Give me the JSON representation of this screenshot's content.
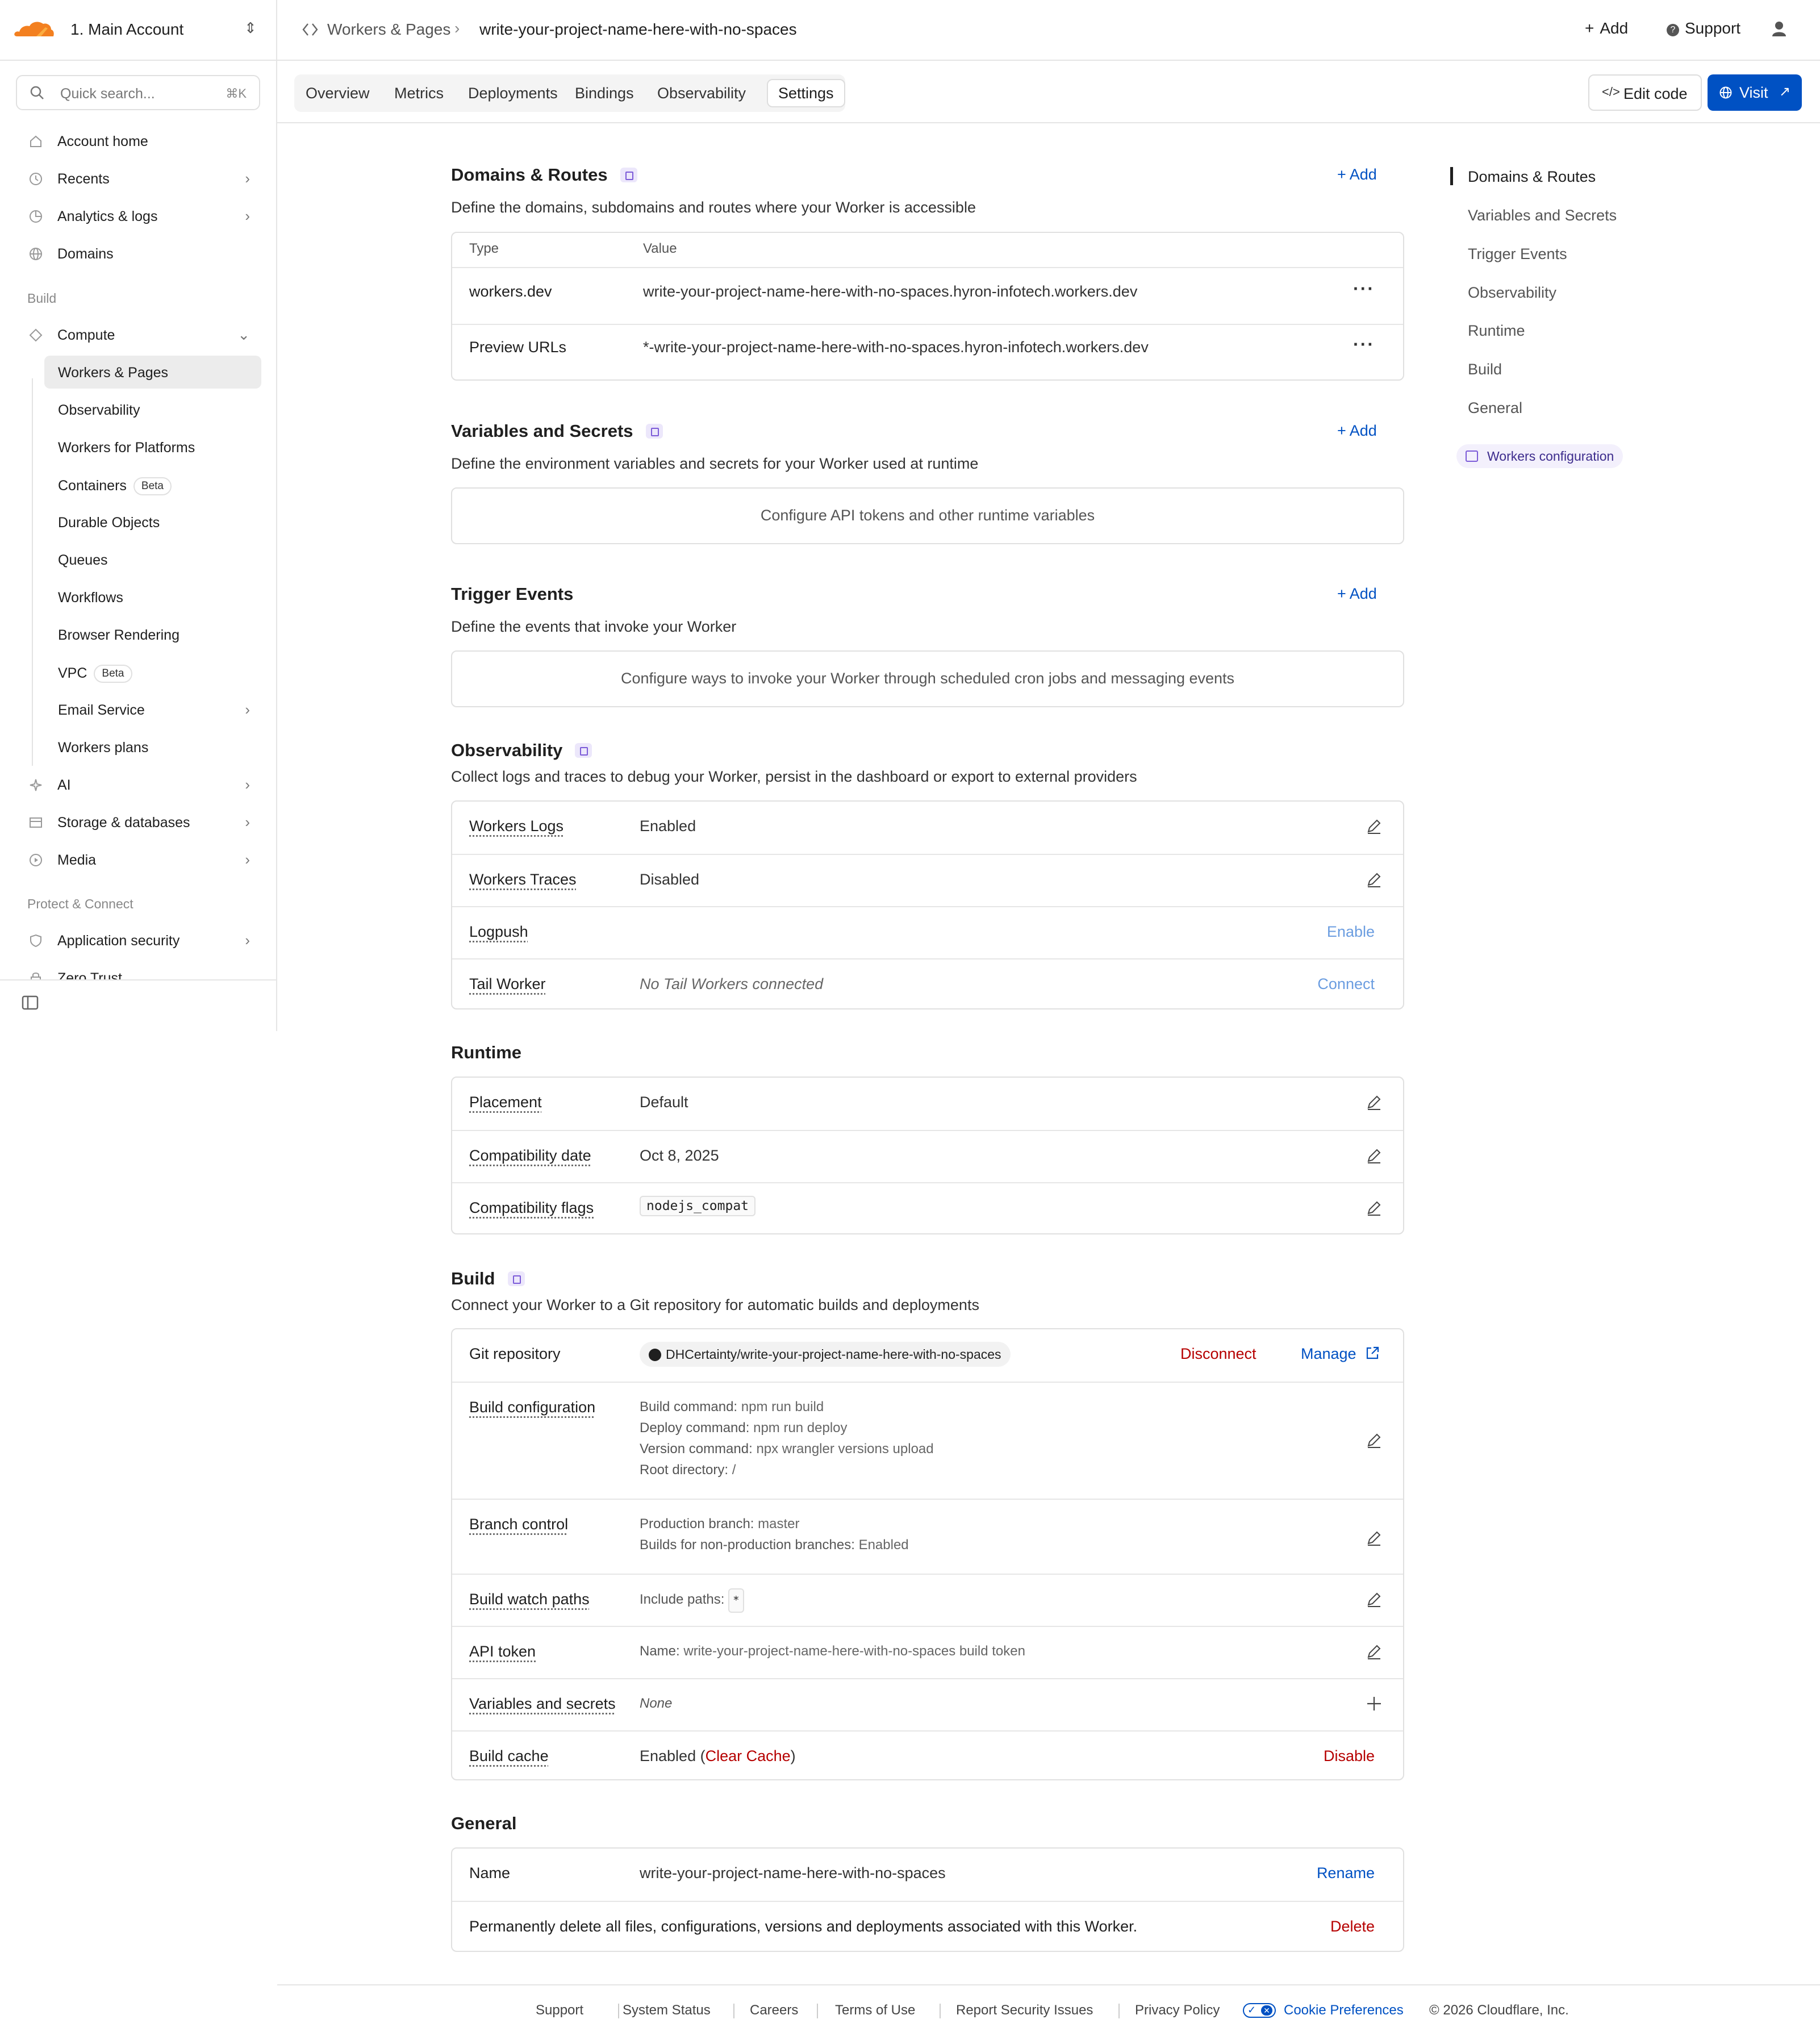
{
  "account": {
    "name": "1. Main Account"
  },
  "search": {
    "placeholder": "Quick search...",
    "shortcut": "⌘K"
  },
  "sidebar": {
    "top_items": [
      {
        "label": "Account home"
      },
      {
        "label": "Recents"
      },
      {
        "label": "Analytics & logs"
      },
      {
        "label": "Domains"
      }
    ],
    "build_heading": "Build",
    "compute": {
      "label": "Compute"
    },
    "compute_items": [
      {
        "label": "Workers & Pages"
      },
      {
        "label": "Observability"
      },
      {
        "label": "Workers for Platforms"
      },
      {
        "label": "Containers",
        "badge": "Beta"
      },
      {
        "label": "Durable Objects"
      },
      {
        "label": "Queues"
      },
      {
        "label": "Workflows"
      },
      {
        "label": "Browser Rendering"
      },
      {
        "label": "VPC",
        "badge": "Beta"
      },
      {
        "label": "Email Service"
      },
      {
        "label": "Workers plans"
      }
    ],
    "more_items": [
      {
        "label": "AI"
      },
      {
        "label": "Storage & databases"
      },
      {
        "label": "Media"
      }
    ],
    "protect_heading": "Protect & Connect",
    "protect_items": [
      {
        "label": "Application security"
      },
      {
        "label": "Zero Trust"
      }
    ]
  },
  "topbar": {
    "breadcrumb_parent": "Workers & Pages",
    "breadcrumb_current": "write-your-project-name-here-with-no-spaces",
    "add_label": "Add",
    "support_label": "Support"
  },
  "tabs": [
    "Overview",
    "Metrics",
    "Deployments",
    "Bindings",
    "Observability",
    "Settings"
  ],
  "actions": {
    "edit_code": "Edit code",
    "visit": "Visit"
  },
  "domains": {
    "title": "Domains & Routes",
    "add": "Add",
    "description": "Define the domains, subdomains and routes where your Worker is accessible",
    "col_type": "Type",
    "col_value": "Value",
    "rows": [
      {
        "type": "workers.dev",
        "value": "write-your-project-name-here-with-no-spaces.hyron-infotech.workers.dev"
      },
      {
        "type": "Preview URLs",
        "value": "*-write-your-project-name-here-with-no-spaces.hyron-infotech.workers.dev"
      }
    ]
  },
  "variables": {
    "title": "Variables and Secrets",
    "add": "Add",
    "description": "Define the environment variables and secrets for your Worker used at runtime",
    "empty": "Configure API tokens and other runtime variables"
  },
  "triggers": {
    "title": "Trigger Events",
    "add": "Add",
    "description": "Define the events that invoke your Worker",
    "empty": "Configure ways to invoke your Worker through scheduled cron jobs and messaging events"
  },
  "observability": {
    "title": "Observability",
    "description": "Collect logs and traces to debug your Worker, persist in the dashboard or export to external providers",
    "rows": [
      {
        "label": "Workers Logs",
        "value": "Enabled"
      },
      {
        "label": "Workers Traces",
        "value": "Disabled"
      },
      {
        "label": "Logpush",
        "value": "",
        "action": "Enable"
      },
      {
        "label": "Tail Worker",
        "value": "No Tail Workers connected",
        "action": "Connect"
      }
    ]
  },
  "runtime": {
    "title": "Runtime",
    "rows": [
      {
        "label": "Placement",
        "value": "Default"
      },
      {
        "label": "Compatibility date",
        "value": "Oct 8, 2025"
      },
      {
        "label": "Compatibility flags",
        "value": "nodejs_compat"
      }
    ]
  },
  "build": {
    "title": "Build",
    "description": "Connect your Worker to a Git repository for automatic builds and deployments",
    "git": {
      "label": "Git repository",
      "repo": "DHCertainty/write-your-project-name-here-with-no-spaces",
      "disconnect": "Disconnect",
      "manage": "Manage"
    },
    "config": {
      "label": "Build configuration",
      "lines": [
        {
          "k": "Build command:",
          "v": "npm run build"
        },
        {
          "k": "Deploy command:",
          "v": "npm run deploy"
        },
        {
          "k": "Version command:",
          "v": "npx wrangler versions upload"
        },
        {
          "k": "Root directory:",
          "v": "/"
        }
      ]
    },
    "branch": {
      "label": "Branch control",
      "lines": [
        {
          "k": "Production branch:",
          "v": "master"
        },
        {
          "k": "Builds for non-production branches:",
          "v": "Enabled"
        }
      ]
    },
    "watch": {
      "label": "Build watch paths",
      "k": "Include paths:",
      "v": "*"
    },
    "token": {
      "label": "API token",
      "k": "Name:",
      "v": "write-your-project-name-here-with-no-spaces build token"
    },
    "vars": {
      "label": "Variables and secrets",
      "v": "None"
    },
    "cache": {
      "label": "Build cache",
      "v": "Enabled",
      "clear": "Clear Cache",
      "disable": "Disable"
    }
  },
  "general": {
    "title": "General",
    "name_label": "Name",
    "name_value": "write-your-project-name-here-with-no-spaces",
    "rename": "Rename",
    "delete_text": "Permanently delete all files, configurations, versions and deployments associated with this Worker.",
    "delete": "Delete"
  },
  "toc": [
    "Domains & Routes",
    "Variables and Secrets",
    "Trigger Events",
    "Observability",
    "Runtime",
    "Build",
    "General"
  ],
  "toc_link": "Workers configuration",
  "footer": [
    "Support",
    "System Status",
    "Careers",
    "Terms of Use",
    "Report Security Issues",
    "Privacy Policy",
    "Cookie Preferences",
    "© 2026 Cloudflare, Inc."
  ],
  "colors": {
    "accent": "#0051c3",
    "danger": "#b60000",
    "brand": "#f38020"
  }
}
